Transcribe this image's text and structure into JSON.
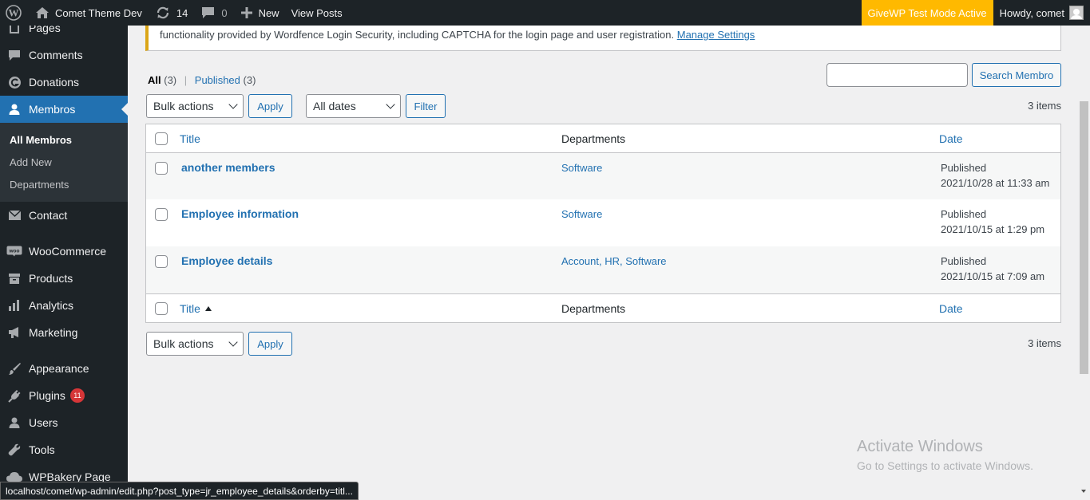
{
  "adminbar": {
    "site_name": "Comet Theme Dev",
    "updates_count": "14",
    "comments_count": "0",
    "new_label": "New",
    "view_posts": "View Posts",
    "givewp_notice": "GiveWP Test Mode Active",
    "howdy": "Howdy, comet"
  },
  "sidebar": {
    "items": [
      {
        "label": "Pages"
      },
      {
        "label": "Comments"
      },
      {
        "label": "Donations"
      },
      {
        "label": "Membros"
      },
      {
        "label": "Contact"
      },
      {
        "label": "WooCommerce"
      },
      {
        "label": "Products"
      },
      {
        "label": "Analytics"
      },
      {
        "label": "Marketing"
      },
      {
        "label": "Appearance"
      },
      {
        "label": "Plugins",
        "badge": "11"
      },
      {
        "label": "Users"
      },
      {
        "label": "Tools"
      },
      {
        "label": "WPBakery Page"
      }
    ],
    "submenu": [
      "All Membros",
      "Add New",
      "Departments"
    ]
  },
  "notice": {
    "text": "functionality provided by Wordfence Login Security, including CAPTCHA for the login page and user registration.",
    "link": "Manage Settings"
  },
  "filters": {
    "all_label": "All",
    "all_count": "(3)",
    "published_label": "Published",
    "published_count": "(3)",
    "search_button": "Search Membro",
    "bulk_actions": "Bulk actions",
    "apply": "Apply",
    "all_dates": "All dates",
    "filter": "Filter",
    "items_count": "3 items"
  },
  "table": {
    "columns": {
      "title": "Title",
      "departments": "Departments",
      "date": "Date"
    },
    "rows": [
      {
        "title": "another members",
        "departments": "Software",
        "status": "Published",
        "date": "2021/10/28 at 11:33 am"
      },
      {
        "title": "Employee information",
        "departments": "Software",
        "status": "Published",
        "date": "2021/10/15 at 1:29 pm"
      },
      {
        "title": "Employee details",
        "departments": "Account, HR, Software",
        "status": "Published",
        "date": "2021/10/15 at 7:09 am"
      }
    ]
  },
  "watermark": {
    "line1": "Activate Windows",
    "line2": "Go to Settings to activate Windows."
  },
  "statusbar": {
    "url": "localhost/comet/wp-admin/edit.php?post_type=jr_employee_details&orderby=titl..."
  }
}
